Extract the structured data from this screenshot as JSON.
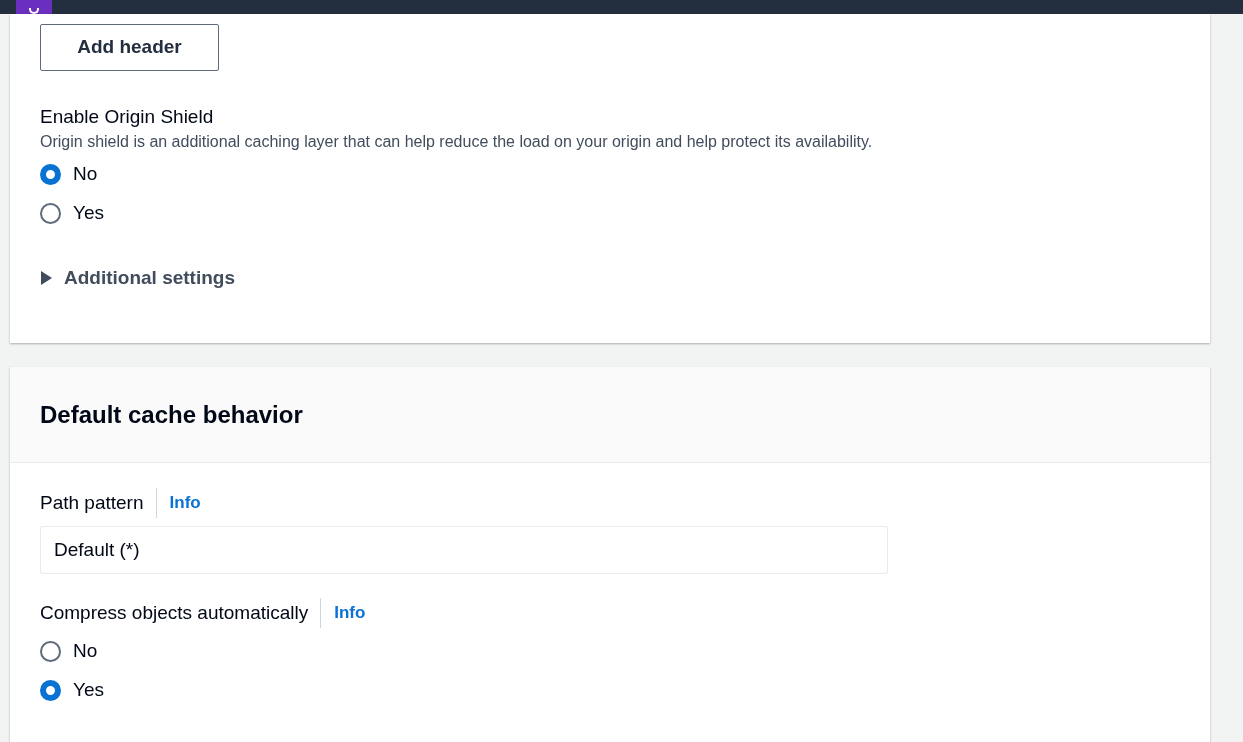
{
  "origin_card": {
    "add_header_button": "Add header",
    "origin_shield": {
      "label": "Enable Origin Shield",
      "description": "Origin shield is an additional caching layer that can help reduce the load on your origin and help protect its availability.",
      "options": [
        {
          "label": "No",
          "selected": true
        },
        {
          "label": "Yes",
          "selected": false
        }
      ]
    },
    "additional_settings": {
      "label": "Additional settings",
      "expanded": false
    }
  },
  "cache_card": {
    "title": "Default cache behavior",
    "path_pattern": {
      "label": "Path pattern",
      "info": "Info",
      "value": "Default (*)"
    },
    "compress": {
      "label": "Compress objects automatically",
      "info": "Info",
      "options": [
        {
          "label": "No",
          "selected": false
        },
        {
          "label": "Yes",
          "selected": true
        }
      ]
    }
  }
}
